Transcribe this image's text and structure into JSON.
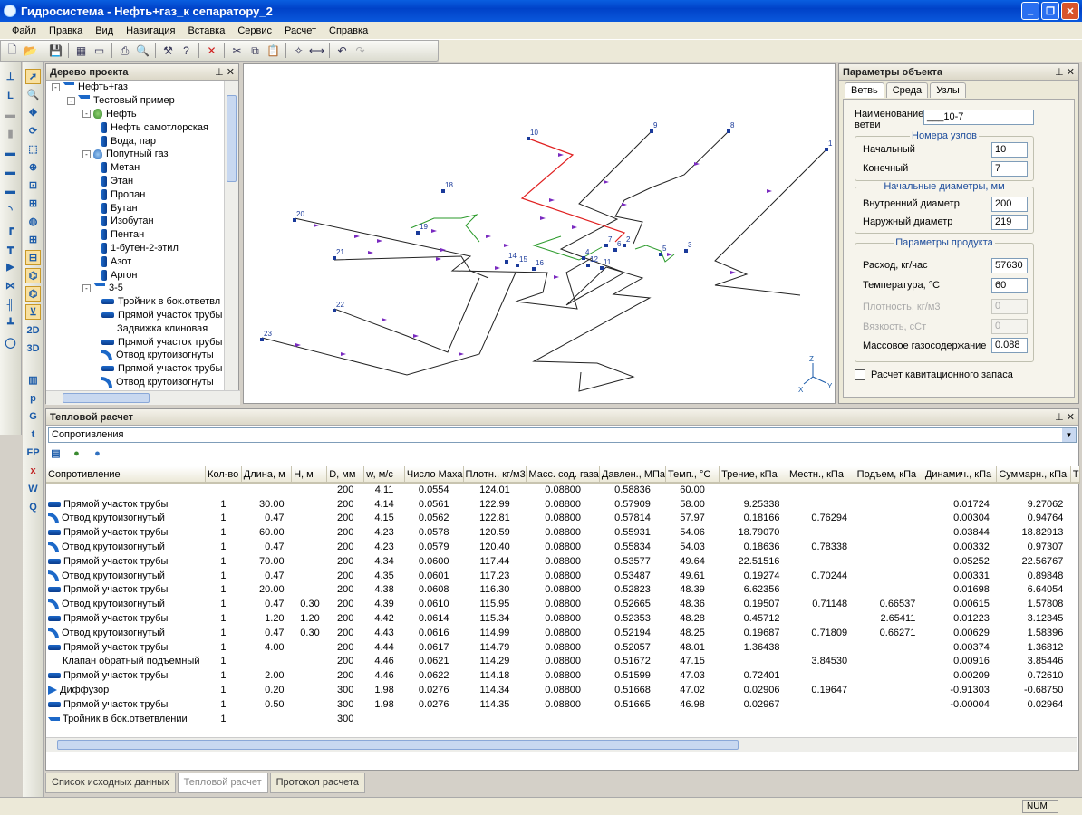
{
  "window": {
    "title": "Гидросистема - Нефть+газ_к сепаратору_2"
  },
  "menu": [
    "Файл",
    "Правка",
    "Вид",
    "Навигация",
    "Вставка",
    "Сервис",
    "Расчет",
    "Справка"
  ],
  "tree": {
    "title": "Дерево проекта",
    "items": [
      {
        "label": "Нефть+газ",
        "level": 0,
        "icon": "tee",
        "exp": "-"
      },
      {
        "label": "Тестовый пример",
        "level": 1,
        "icon": "tee",
        "exp": "-"
      },
      {
        "label": "Нефть",
        "level": 2,
        "icon": "flask",
        "exp": "-"
      },
      {
        "label": "Нефть самотлорская",
        "level": 3,
        "icon": "vert",
        "exp": ""
      },
      {
        "label": "Вода, пар",
        "level": 3,
        "icon": "vert",
        "exp": ""
      },
      {
        "label": "Попутный газ",
        "level": 2,
        "icon": "flaskb",
        "exp": "-"
      },
      {
        "label": "Метан",
        "level": 3,
        "icon": "vert",
        "exp": ""
      },
      {
        "label": "Этан",
        "level": 3,
        "icon": "vert",
        "exp": ""
      },
      {
        "label": "Пропан",
        "level": 3,
        "icon": "vert",
        "exp": ""
      },
      {
        "label": "Бутан",
        "level": 3,
        "icon": "vert",
        "exp": ""
      },
      {
        "label": "Изобутан",
        "level": 3,
        "icon": "vert",
        "exp": ""
      },
      {
        "label": "Пентан",
        "level": 3,
        "icon": "vert",
        "exp": ""
      },
      {
        "label": "1-бутен-2-этил",
        "level": 3,
        "icon": "vert",
        "exp": ""
      },
      {
        "label": "Азот",
        "level": 3,
        "icon": "vert",
        "exp": ""
      },
      {
        "label": "Аргон",
        "level": 3,
        "icon": "vert",
        "exp": ""
      },
      {
        "label": "3-5",
        "level": 2,
        "icon": "tee",
        "exp": "-"
      },
      {
        "label": "Тройник в бок.ответвл",
        "level": 3,
        "icon": "pipe",
        "exp": ""
      },
      {
        "label": "Прямой участок трубы",
        "level": 3,
        "icon": "pipe",
        "exp": ""
      },
      {
        "label": "Задвижка клиновая",
        "level": 3,
        "icon": "valve",
        "exp": ""
      },
      {
        "label": "Прямой участок трубы",
        "level": 3,
        "icon": "pipe",
        "exp": ""
      },
      {
        "label": "Отвод крутоизогнуты",
        "level": 3,
        "icon": "elbow",
        "exp": ""
      },
      {
        "label": "Прямой участок трубы",
        "level": 3,
        "icon": "pipe",
        "exp": ""
      },
      {
        "label": "Отвод крутоизогнуты",
        "level": 3,
        "icon": "elbow",
        "exp": ""
      }
    ]
  },
  "diagram": {
    "nodes": [
      "1",
      "2",
      "3",
      "4",
      "5",
      "6",
      "7",
      "8",
      "9",
      "10",
      "11",
      "12",
      "14",
      "15",
      "16",
      "18",
      "19",
      "20",
      "21",
      "22",
      "23"
    ],
    "axes": [
      "Z",
      "X",
      "Y"
    ]
  },
  "props": {
    "title": "Параметры объекта",
    "tabs": [
      "Ветвь",
      "Среда",
      "Узлы"
    ],
    "branch_name_label": "Наименование ветви",
    "branch_name": "___10-7",
    "nodes_group": "Номера узлов",
    "start_label": "Начальный",
    "start": "10",
    "end_label": "Конечный",
    "end": "7",
    "diam_group": "Начальные диаметры, мм",
    "inner_label": "Внутренний диаметр",
    "inner": "200",
    "outer_label": "Наружный диаметр",
    "outer": "219",
    "product_group": "Параметры продукта",
    "flow_label": "Расход, кг/час",
    "flow": "57630",
    "temp_label": "Температура, °С",
    "temp": "60",
    "density_label": "Плотность, кг/м3",
    "density": "0",
    "visc_label": "Вязкость, сСт",
    "visc": "0",
    "gas_label": "Массовое газосодержание",
    "gas": "0.088",
    "cav_label": "Расчет кавитационного запаса"
  },
  "thermal": {
    "title": "Тепловой расчет",
    "dropdown": "Сопротивления",
    "columns": [
      "Сопротивление",
      "Кол-во",
      "Длина, м",
      "Н, м",
      "D, мм",
      "w, м/с",
      "Число Маха",
      "Плотн., кг/м3",
      "Масс. сод. газа",
      "Давлен., МПа",
      "Темп., °С",
      "Трение, кПа",
      "Местн., кПа",
      "Подъем, кПа",
      "Динамич., кПа",
      "Суммарн., кПа",
      "Т"
    ],
    "rows": [
      [
        "",
        "",
        "",
        "",
        "200",
        "4.11",
        "0.0554",
        "124.01",
        "0.08800",
        "0.58836",
        "60.00",
        "",
        "",
        "",
        "",
        ""
      ],
      [
        "Прямой участок трубы",
        "1",
        "30.00",
        "",
        "200",
        "4.14",
        "0.0561",
        "122.99",
        "0.08800",
        "0.57909",
        "58.00",
        "9.25338",
        "",
        "",
        "0.01724",
        "9.27062"
      ],
      [
        "Отвод крутоизогнутый",
        "1",
        "0.47",
        "",
        "200",
        "4.15",
        "0.0562",
        "122.81",
        "0.08800",
        "0.57814",
        "57.97",
        "0.18166",
        "0.76294",
        "",
        "0.00304",
        "0.94764"
      ],
      [
        "Прямой участок трубы",
        "1",
        "60.00",
        "",
        "200",
        "4.23",
        "0.0578",
        "120.59",
        "0.08800",
        "0.55931",
        "54.06",
        "18.79070",
        "",
        "",
        "0.03844",
        "18.82913"
      ],
      [
        "Отвод крутоизогнутый",
        "1",
        "0.47",
        "",
        "200",
        "4.23",
        "0.0579",
        "120.40",
        "0.08800",
        "0.55834",
        "54.03",
        "0.18636",
        "0.78338",
        "",
        "0.00332",
        "0.97307"
      ],
      [
        "Прямой участок трубы",
        "1",
        "70.00",
        "",
        "200",
        "4.34",
        "0.0600",
        "117.44",
        "0.08800",
        "0.53577",
        "49.64",
        "22.51516",
        "",
        "",
        "0.05252",
        "22.56767"
      ],
      [
        "Отвод крутоизогнутый",
        "1",
        "0.47",
        "",
        "200",
        "4.35",
        "0.0601",
        "117.23",
        "0.08800",
        "0.53487",
        "49.61",
        "0.19274",
        "0.70244",
        "",
        "0.00331",
        "0.89848"
      ],
      [
        "Прямой участок трубы",
        "1",
        "20.00",
        "",
        "200",
        "4.38",
        "0.0608",
        "116.30",
        "0.08800",
        "0.52823",
        "48.39",
        "6.62356",
        "",
        "",
        "0.01698",
        "6.64054"
      ],
      [
        "Отвод крутоизогнутый",
        "1",
        "0.47",
        "0.30",
        "200",
        "4.39",
        "0.0610",
        "115.95",
        "0.08800",
        "0.52665",
        "48.36",
        "0.19507",
        "0.71148",
        "0.66537",
        "0.00615",
        "1.57808"
      ],
      [
        "Прямой участок трубы",
        "1",
        "1.20",
        "1.20",
        "200",
        "4.42",
        "0.0614",
        "115.34",
        "0.08800",
        "0.52353",
        "48.28",
        "0.45712",
        "",
        "2.65411",
        "0.01223",
        "3.12345"
      ],
      [
        "Отвод крутоизогнутый",
        "1",
        "0.47",
        "0.30",
        "200",
        "4.43",
        "0.0616",
        "114.99",
        "0.08800",
        "0.52194",
        "48.25",
        "0.19687",
        "0.71809",
        "0.66271",
        "0.00629",
        "1.58396"
      ],
      [
        "Прямой участок трубы",
        "1",
        "4.00",
        "",
        "200",
        "4.44",
        "0.0617",
        "114.79",
        "0.08800",
        "0.52057",
        "48.01",
        "1.36438",
        "",
        "",
        "0.00374",
        "1.36812"
      ],
      [
        "Клапан обратный подъемный",
        "1",
        "",
        "",
        "200",
        "4.46",
        "0.0621",
        "114.29",
        "0.08800",
        "0.51672",
        "47.15",
        "",
        "3.84530",
        "",
        "0.00916",
        "3.85446"
      ],
      [
        "Прямой участок трубы",
        "1",
        "2.00",
        "",
        "200",
        "4.46",
        "0.0622",
        "114.18",
        "0.08800",
        "0.51599",
        "47.03",
        "0.72401",
        "",
        "",
        "0.00209",
        "0.72610"
      ],
      [
        "Диффузор",
        "1",
        "0.20",
        "",
        "300",
        "1.98",
        "0.0276",
        "114.34",
        "0.08800",
        "0.51668",
        "47.02",
        "0.02906",
        "0.19647",
        "",
        "-0.91303",
        "-0.68750"
      ],
      [
        "Прямой участок трубы",
        "1",
        "0.50",
        "",
        "300",
        "1.98",
        "0.0276",
        "114.35",
        "0.08800",
        "0.51665",
        "46.98",
        "0.02967",
        "",
        "",
        "-0.00004",
        "0.02964"
      ],
      [
        "Тройник в бок.ответвлении",
        "1",
        "",
        "",
        "300",
        "",
        "",
        "",
        "",
        "",
        "",
        "",
        "",
        "",
        "",
        ""
      ]
    ],
    "row_icons": [
      "",
      "pipe",
      "elbow",
      "pipe",
      "elbow",
      "pipe",
      "elbow",
      "pipe",
      "elbow",
      "pipe",
      "elbow",
      "pipe",
      "valve",
      "pipe",
      "diff",
      "pipe",
      "tee"
    ]
  },
  "bottom_tabs": [
    "Список исходных данных",
    "Тепловой расчет",
    "Протокол расчета"
  ],
  "status": {
    "num": "NUM"
  }
}
